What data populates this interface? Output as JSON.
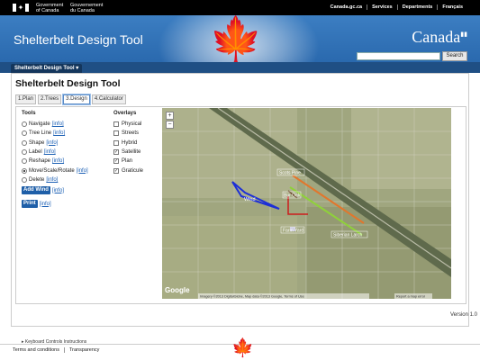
{
  "gc": {
    "signature_en": [
      "Government",
      "of Canada"
    ],
    "signature_fr": [
      "Gouvernement",
      "du Canada"
    ],
    "links": [
      "Canada.gc.ca",
      "Services",
      "Departments",
      "Français"
    ]
  },
  "banner": {
    "title": "Shelterbelt Design Tool",
    "wordmark": "Canada",
    "search_button": "Search",
    "search_value": ""
  },
  "breadcrumb": {
    "label": "Shelterbelt Design Tool"
  },
  "page": {
    "title": "Shelterbelt Design Tool",
    "tabs": [
      "1.Plan",
      "2.Trees",
      "3.Design",
      "4.Calculator"
    ],
    "active_tab": "3.Design"
  },
  "tools": {
    "heading": "Tools",
    "info_text": "[info]",
    "items": [
      {
        "label": "Navigate",
        "selected": false
      },
      {
        "label": "Tree Line",
        "selected": false
      },
      {
        "label": "Shape",
        "selected": false
      },
      {
        "label": "Label",
        "selected": false
      },
      {
        "label": "Reshape",
        "selected": false
      },
      {
        "label": "Move/Scale/Rotate",
        "selected": true
      },
      {
        "label": "Delete",
        "selected": false
      }
    ],
    "add_wind": "Add Wind",
    "print": "Print"
  },
  "overlays": {
    "heading": "Overlays",
    "items": [
      {
        "label": "Physical",
        "checked": false
      },
      {
        "label": "Streets",
        "checked": false
      },
      {
        "label": "Hybrid",
        "checked": false
      },
      {
        "label": "Satellite",
        "checked": true
      },
      {
        "label": "Plan",
        "checked": true
      },
      {
        "label": "Graticule",
        "checked": true
      }
    ]
  },
  "map": {
    "zoom_in": "+",
    "zoom_out": "−",
    "labels": {
      "wind": "Wind",
      "scots_pine": "Scots Pine",
      "bur_oak": "Bur Oak",
      "siberian_larch": "Siberian Larch",
      "farm_yard": "Farm Yard"
    },
    "google": "Google",
    "attribution": "Imagery ©2013 DigitalGlobe, Map data ©2013 Google, Terms of Use",
    "report": "Report a map error",
    "colors": {
      "wind": "#1d2fd6",
      "scots_pine": "#e2762c",
      "bur_oak": "#6b4a2a",
      "siberian_larch": "#8fd13a",
      "farm_yard": "#cc1d1d"
    }
  },
  "keyboard_link": "▸ Keyboard Controls Instructions",
  "version": "Version 1.0",
  "footer": {
    "links": [
      "Terms and conditions",
      "Transparency"
    ]
  }
}
